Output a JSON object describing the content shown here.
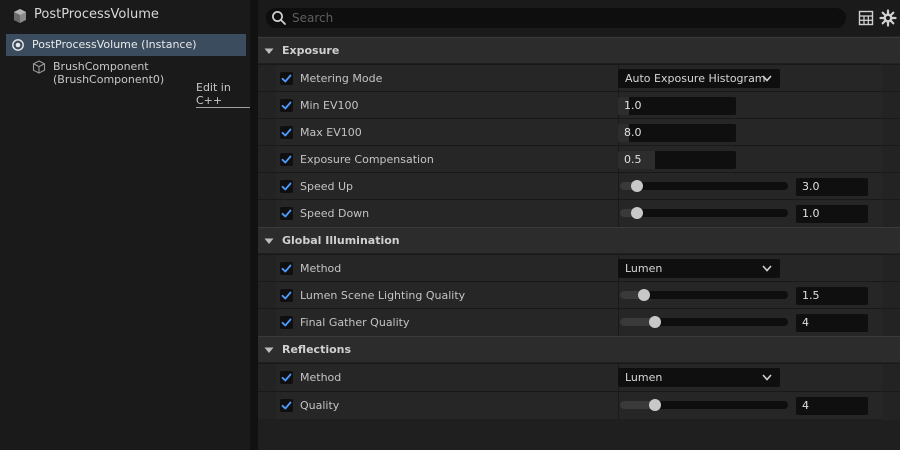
{
  "left_panel": {
    "actor_title": "PostProcessVolume",
    "tree": [
      {
        "label": "PostProcessVolume (Instance)"
      },
      {
        "label": "BrushComponent (BrushComponent0)"
      }
    ],
    "edit_link": "Edit in C++"
  },
  "toolbar": {
    "search_placeholder": "Search",
    "icons": [
      "search-icon",
      "table-view-icon",
      "gear-icon"
    ]
  },
  "colors": {
    "accent": "#4c9aff",
    "selection": "#3b4c5e",
    "panel": "#1a1a1a",
    "field": "#0f0f0f"
  },
  "sections": [
    {
      "title": "Exposure",
      "props": [
        {
          "label": "Metering Mode",
          "kind": "dropdown",
          "value": "Auto Exposure Histogram",
          "checked": true
        },
        {
          "label": "Min EV100",
          "kind": "number",
          "value": "1.0",
          "fill": 0.09,
          "checked": true
        },
        {
          "label": "Max EV100",
          "kind": "number",
          "value": "8.0",
          "fill": 0.09,
          "checked": true
        },
        {
          "label": "Exposure Compensation",
          "kind": "number",
          "value": "0.5",
          "fill": 0.31,
          "checked": true
        },
        {
          "label": "Speed Up",
          "kind": "slider",
          "value": "3.0",
          "level": 0.1,
          "checked": true
        },
        {
          "label": "Speed Down",
          "kind": "slider",
          "value": "1.0",
          "level": 0.1,
          "checked": true
        }
      ]
    },
    {
      "title": "Global Illumination",
      "props": [
        {
          "label": "Method",
          "kind": "dropdown",
          "value": "Lumen",
          "checked": true
        },
        {
          "label": "Lumen Scene Lighting Quality",
          "kind": "slider",
          "value": "1.5",
          "level": 0.14,
          "checked": true
        },
        {
          "label": "Final Gather Quality",
          "kind": "slider",
          "value": "4",
          "level": 0.21,
          "checked": true
        }
      ]
    },
    {
      "title": "Reflections",
      "props": [
        {
          "label": "Method",
          "kind": "dropdown",
          "value": "Lumen",
          "checked": true
        },
        {
          "label": "Quality",
          "kind": "slider",
          "value": "4",
          "level": 0.21,
          "checked": true
        }
      ]
    }
  ]
}
